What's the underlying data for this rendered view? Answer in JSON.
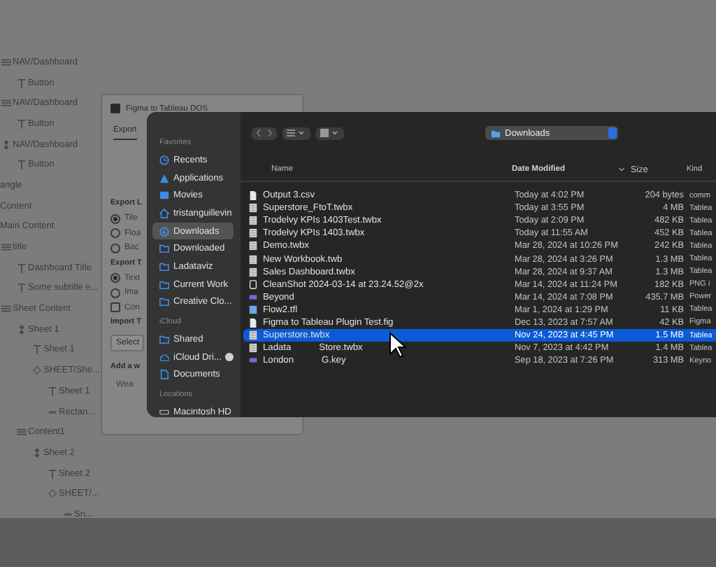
{
  "layers": [
    {
      "label": "NAV/Dashboard",
      "kind": "frame",
      "children": [
        {
          "label": "Button",
          "kind": "text"
        }
      ]
    },
    {
      "label": "NAV/Dashboard",
      "kind": "frame",
      "children": [
        {
          "label": "Button",
          "kind": "text"
        }
      ]
    },
    {
      "label": "NAV/Dashboard",
      "kind": "component",
      "children": [
        {
          "label": "Button",
          "kind": "text"
        }
      ]
    },
    {
      "label": "angle",
      "kind": "clipped"
    },
    {
      "label": "Content",
      "kind": "clipped"
    },
    {
      "label": "Main Content",
      "kind": "clipped"
    },
    {
      "label": "title",
      "kind": "frame",
      "children": [
        {
          "label": "Dashboard Title",
          "kind": "text"
        },
        {
          "label": "Some subtitle e...",
          "kind": "text"
        }
      ]
    },
    {
      "label": "Sheet Content",
      "kind": "frame",
      "children": [
        {
          "label": "Sheet 1",
          "kind": "component",
          "children": [
            {
              "label": "Sheet 1",
              "kind": "text"
            },
            {
              "label": "SHEET/She...",
              "kind": "instance",
              "children": [
                {
                  "label": "Sheet 1",
                  "kind": "text"
                },
                {
                  "label": "Rectan...",
                  "kind": "rect"
                }
              ]
            }
          ]
        },
        {
          "label": "Content1",
          "kind": "frame",
          "children": [
            {
              "label": "Sheet 2",
              "kind": "component",
              "children": [
                {
                  "label": "Sheet 2",
                  "kind": "text"
                },
                {
                  "label": "SHEET/...",
                  "kind": "instance",
                  "children": [
                    {
                      "label": "Sn...",
                      "kind": "rect"
                    }
                  ]
                }
              ]
            }
          ]
        }
      ]
    }
  ],
  "plugin": {
    "title": "Figma to Tableau DOS",
    "tabs": [
      {
        "label": "Export",
        "selected": true
      }
    ],
    "sections": [
      {
        "kind": "heading",
        "label": "Export L"
      },
      {
        "kind": "radio",
        "label": "Tile",
        "checked": true
      },
      {
        "kind": "radio",
        "label": "Floa",
        "checked": false
      },
      {
        "kind": "radio",
        "label": "Bac",
        "checked": false
      },
      {
        "kind": "heading",
        "label": "Export T"
      },
      {
        "kind": "radio",
        "label": "Text",
        "checked": true
      },
      {
        "kind": "radio",
        "label": "Ima",
        "checked": false
      },
      {
        "kind": "checkbox",
        "label": "Con",
        "checked": false
      },
      {
        "kind": "heading",
        "label": "Import T"
      },
      {
        "kind": "button",
        "label": "Select"
      },
      {
        "kind": "heading",
        "label": "Add a w"
      },
      {
        "kind": "field",
        "placeholder": "Wea"
      }
    ]
  },
  "dialog": {
    "sidebar": [
      {
        "heading": "Favorites",
        "items": [
          {
            "label": "Recents",
            "kind": "clock",
            "selected": false
          },
          {
            "label": "Applications",
            "kind": "apps",
            "selected": false
          },
          {
            "label": "Movies",
            "kind": "film",
            "selected": false
          },
          {
            "label": "tristanguillevin",
            "kind": "home",
            "selected": false
          },
          {
            "label": "Downloads",
            "kind": "download",
            "selected": true
          },
          {
            "label": "Downloaded",
            "kind": "folder",
            "selected": false
          },
          {
            "label": "Ladataviz",
            "kind": "folder",
            "selected": false
          },
          {
            "label": "Current Work",
            "kind": "folder",
            "selected": false
          },
          {
            "label": "Creative Clo...",
            "kind": "folder",
            "selected": false
          }
        ]
      },
      {
        "heading": "iCloud",
        "items": [
          {
            "label": "Shared",
            "kind": "shared",
            "selected": false
          },
          {
            "label": "iCloud Dri...",
            "kind": "cloud",
            "selected": false
          },
          {
            "label": "Documents",
            "kind": "doc",
            "selected": false
          }
        ]
      },
      {
        "heading": "Locations",
        "items": [
          {
            "label": "Macintosh HD",
            "kind": "disk",
            "selected": false
          }
        ]
      }
    ],
    "location": "Downloads",
    "columns": [
      {
        "label": "Name",
        "sorted": false
      },
      {
        "label": "Date Modified",
        "sorted": true
      },
      {
        "label": "Size",
        "sorted": false
      },
      {
        "label": "Kind",
        "sorted": false
      }
    ],
    "rows": [
      {
        "name": "Output 3.csv",
        "kind": "doc",
        "date": "Today at 4:02 PM",
        "size": "204 bytes",
        "type_label": "comm",
        "selected": false
      },
      {
        "name": "Superstore_FtoT.twbx",
        "kind": "tableau",
        "date": "Today at 3:55 PM",
        "size": "4 MB",
        "type_label": "Tablea",
        "selected": false
      },
      {
        "name": "Trodelvy KPIs 1403Test.twbx",
        "kind": "tableau",
        "date": "Today at 2:09 PM",
        "size": "482 KB",
        "type_label": "Tablea",
        "selected": false
      },
      {
        "name": "Trodelvy KPIs 1403.twbx",
        "kind": "tableau",
        "date": "Today at 11:55 AM",
        "size": "452 KB",
        "type_label": "Tablea",
        "selected": false
      },
      {
        "name": "Demo.twbx",
        "kind": "tableau",
        "date": "Mar 28, 2024 at 10:26 PM",
        "size": "242 KB",
        "type_label": "Tablea",
        "selected": false
      },
      {
        "name": "New Workbook.twb",
        "kind": "tableau",
        "date": "Mar 28, 2024 at 3:26 PM",
        "size": "1.3 MB",
        "type_label": "Tablea",
        "selected": false
      },
      {
        "name": "Sales Dashboard.twbx",
        "kind": "tableau",
        "date": "Mar 28, 2024 at 9:37 AM",
        "size": "1.3 MB",
        "type_label": "Tablea",
        "selected": false
      },
      {
        "name": "CleanShot 2024-03-14 at 23.24.52@2x",
        "kind": "image",
        "date": "Mar 14, 2024 at 11:24 PM",
        "size": "182 KB",
        "type_label": "PNG i",
        "selected": false
      },
      {
        "name": "Beyond",
        "kind": "slides",
        "date": "Mar 14, 2024 at 7:08 PM",
        "size": "435.7 MB",
        "type_label": "Power",
        "selected": false
      },
      {
        "name": "Flow2.tfl",
        "kind": "flow",
        "date": "Mar 1, 2024 at 1:29 PM",
        "size": "11 KB",
        "type_label": "Tablea",
        "selected": false
      },
      {
        "name": "Figma to Tableau Plugin Test.fig",
        "kind": "doc",
        "date": "Dec 13, 2023 at 7:57 AM",
        "size": "42 KB",
        "type_label": "Figma",
        "selected": false
      },
      {
        "name": "Superstore.twbx",
        "kind": "tableau",
        "date": "Nov 24, 2023 at 4:45 PM",
        "size": "1.5 MB",
        "type_label": "Tablea",
        "selected": true
      },
      {
        "name": "Ladata",
        "name_end": "Store.twbx",
        "kind": "tableau",
        "date": "Nov 7, 2023 at 4:42 PM",
        "size": "1.4 MB",
        "type_label": "Tablea",
        "selected": false
      },
      {
        "name": "London",
        "name_end": "G.key",
        "kind": "slides",
        "date": "Sep 18, 2023 at 7:26 PM",
        "size": "313 MB",
        "type_label": "Keyno",
        "selected": false
      }
    ]
  }
}
